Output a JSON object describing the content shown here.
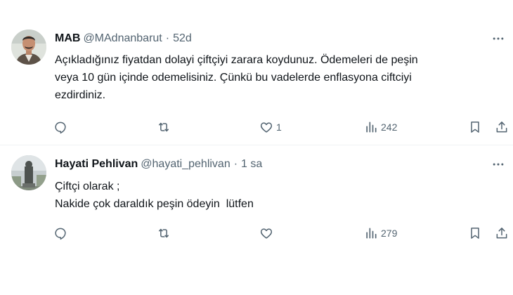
{
  "colors": {
    "text": "#0f1419",
    "secondary": "#536471",
    "divider": "#eff3f4",
    "background": "#ffffff"
  },
  "tweets": [
    {
      "author_name": "MAB",
      "handle": "@MAdnanbarut",
      "separator": "·",
      "time": "52d",
      "avatar_icon": "avatar-photo-man-icon",
      "lines": [
        "Açıkladığınız fiyatdan dolayi çiftçiyi zarara koydunuz. Ödemeleri de peşin",
        "veya 10 gün içinde odemelisiniz. Çünkü bu vadelerde enflasyona ciftciyi",
        "ezdirdiniz."
      ],
      "likes": "1",
      "views": "242"
    },
    {
      "author_name": "Hayati Pehlivan",
      "handle": "@hayati_pehlivan",
      "separator": "·",
      "time": "1 sa",
      "avatar_icon": "avatar-photo-monument-icon",
      "lines": [
        "Çiftçi olarak ;",
        "Nakide çok daraldık peşin ödeyin  lütfen"
      ],
      "likes": "",
      "views": "279"
    }
  ]
}
